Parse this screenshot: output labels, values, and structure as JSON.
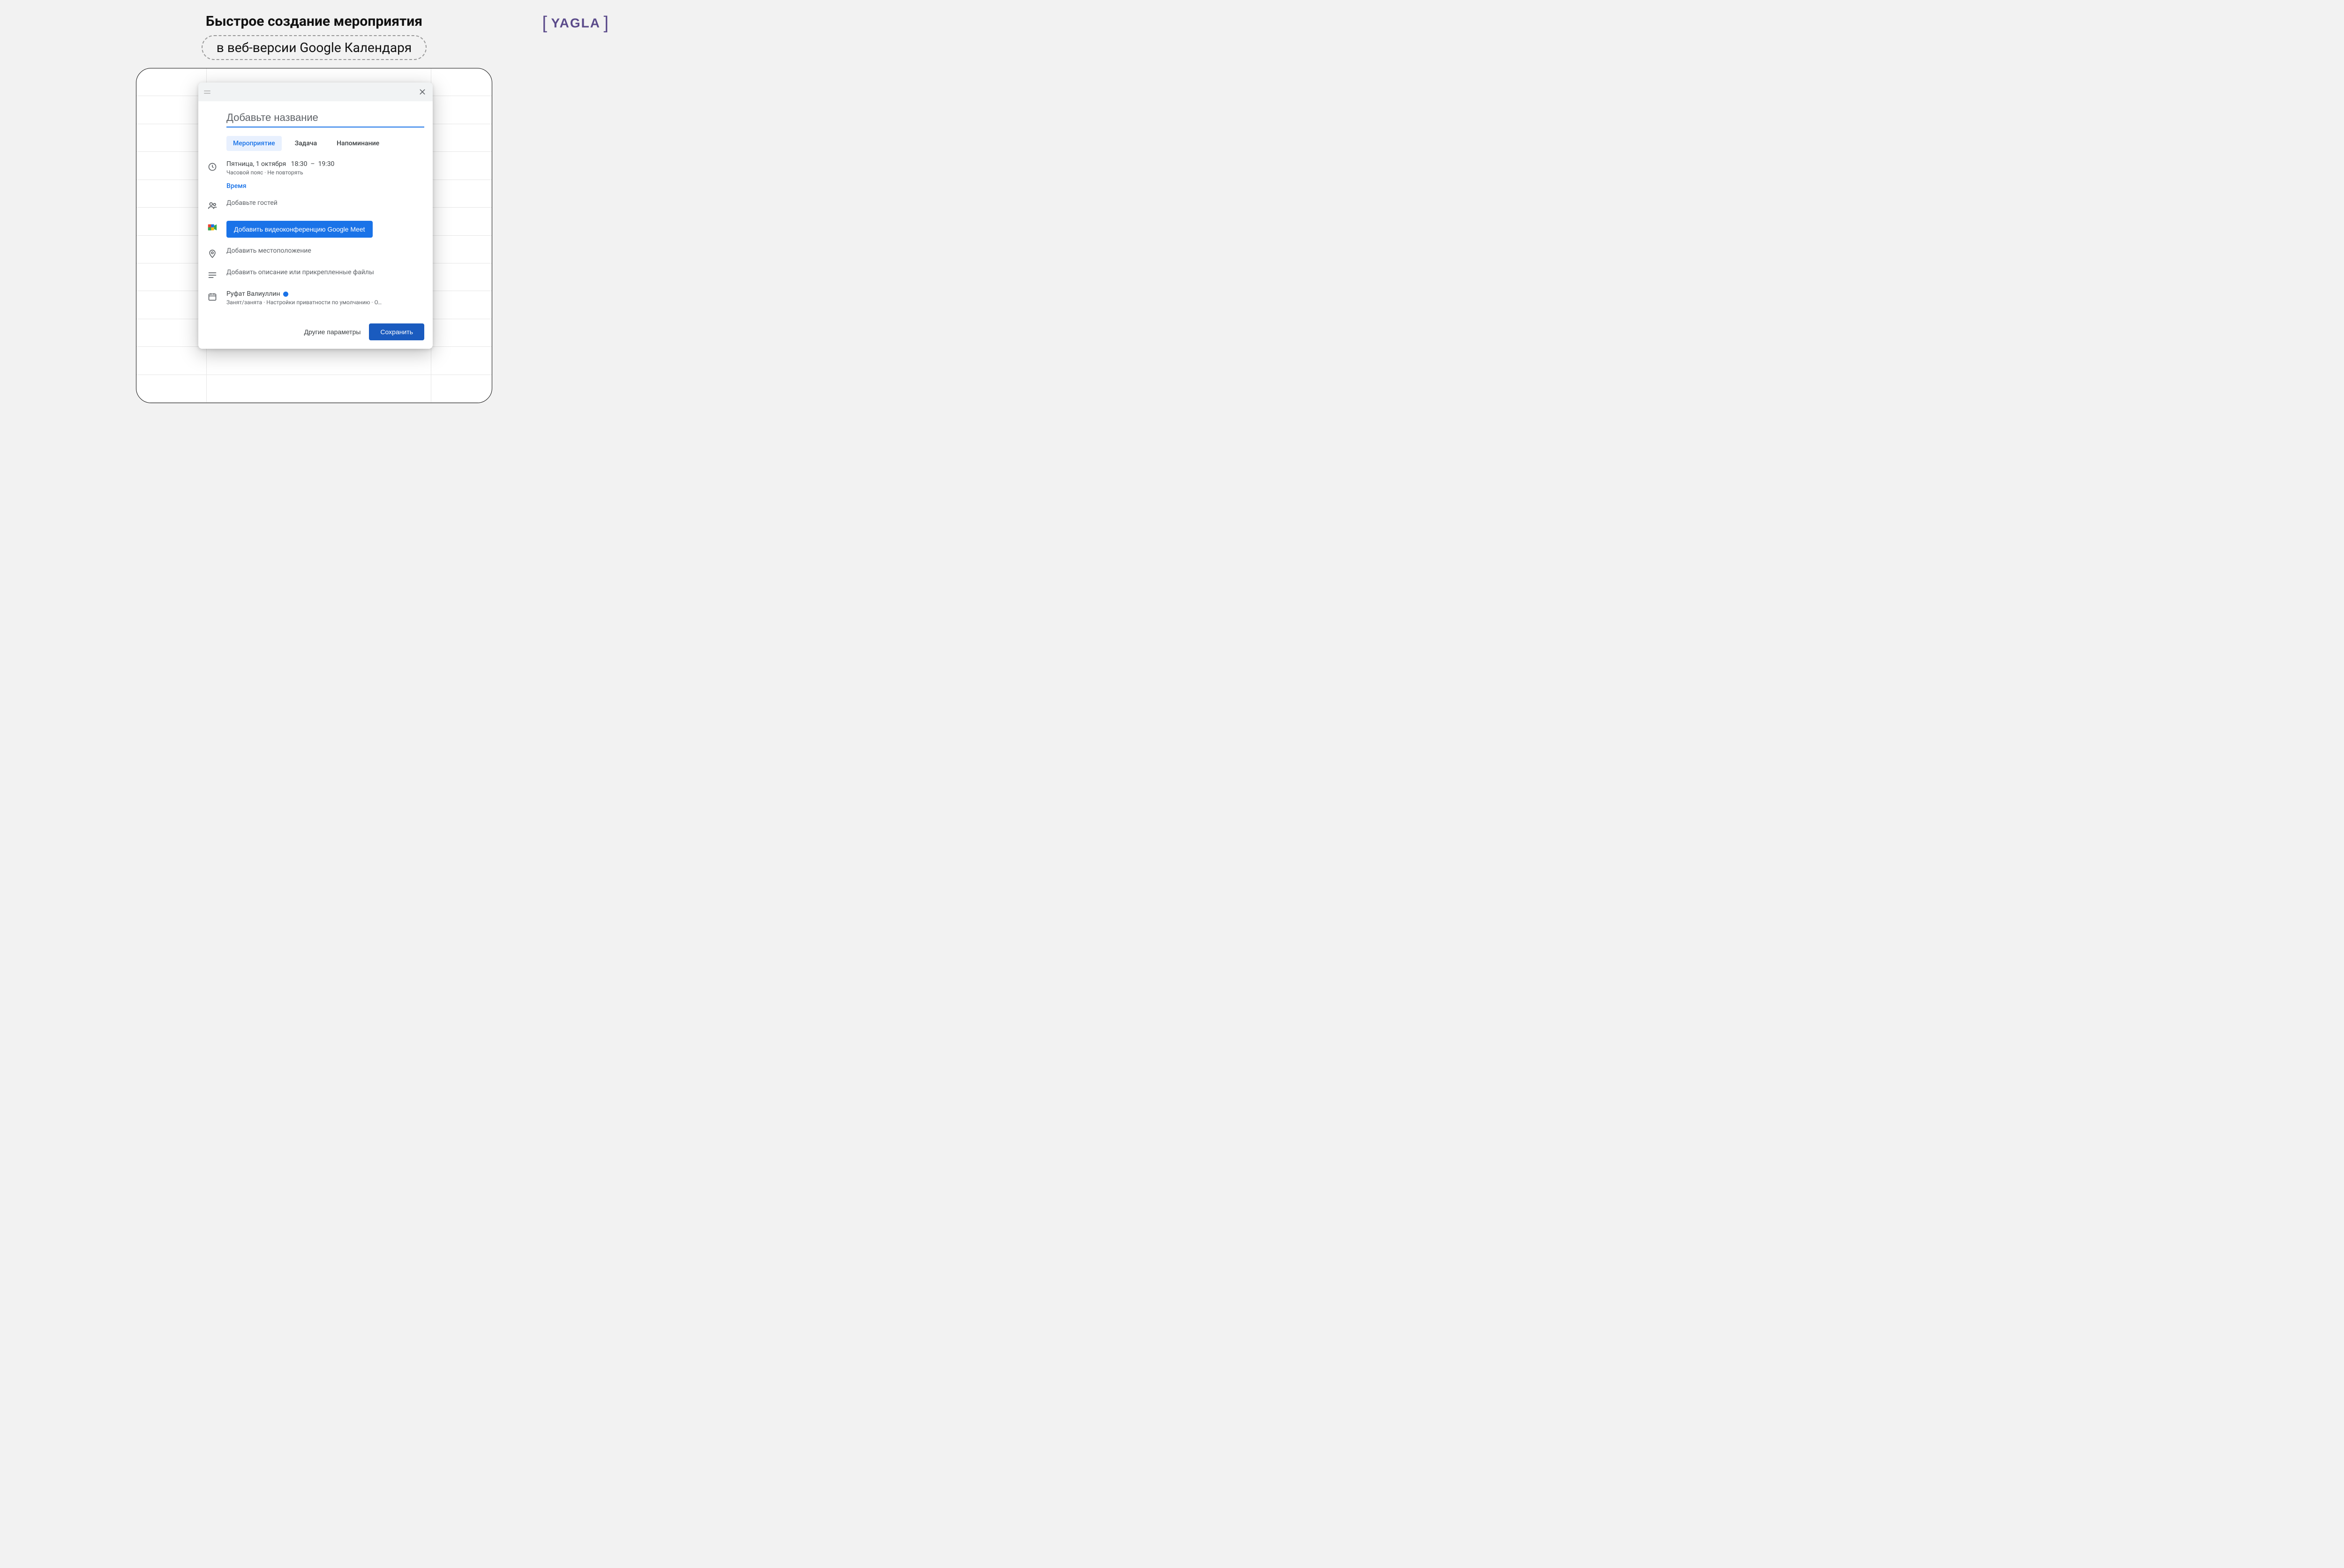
{
  "logo": {
    "text": "YAGLA"
  },
  "headline": {
    "title": "Быстрое создание мероприятия",
    "subtitle": "в веб-версии Google Календаря"
  },
  "popup": {
    "title_placeholder": "Добавьте название",
    "tabs": {
      "event": "Мероприятие",
      "task": "Задача",
      "reminder": "Напоминание"
    },
    "datetime": {
      "date": "Пятница, 1 октября",
      "start": "18:30",
      "end": "19:30",
      "sub": "Часовой пояс · Не повторять",
      "time_link": "Время"
    },
    "guests_placeholder": "Добавьте гостей",
    "meet_button": "Добавить видеоконференцию Google Meet",
    "location_placeholder": "Добавить местоположение",
    "description_placeholder": "Добавить описание или прикрепленные файлы",
    "calendar": {
      "owner": "Руфат Валиуллин",
      "sub": "Занят/занята · Настройки приватности по умолчанию · О…"
    },
    "footer": {
      "more": "Другие параметры",
      "save": "Сохранить"
    }
  }
}
